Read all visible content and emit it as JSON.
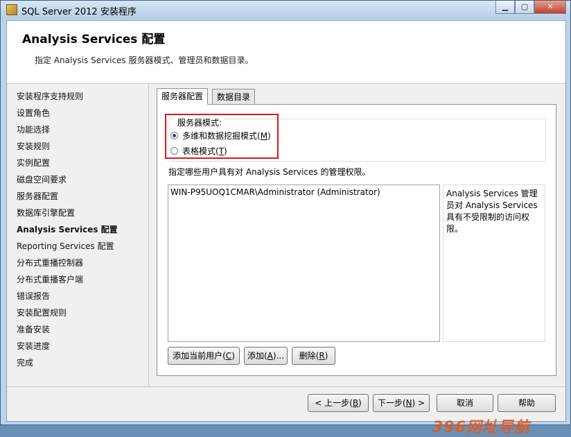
{
  "window": {
    "title": "SQL Server 2012 安装程序",
    "controls": {
      "minimize": "▁",
      "maximize": "▢",
      "close": "✕"
    }
  },
  "header": {
    "title": "Analysis  Services 配置",
    "subtitle": "指定 Analysis  Services 服务器模式、管理员和数据目录。"
  },
  "nav": {
    "items": [
      "安装程序支持规则",
      "设置角色",
      "功能选择",
      "安装规则",
      "实例配置",
      "磁盘空间要求",
      "服务器配置",
      "数据库引擎配置",
      "Analysis Services 配置",
      "Reporting Services 配置",
      "分布式重播控制器",
      "分布式重播客户端",
      "错误报告",
      "安装配置规则",
      "准备安装",
      "安装进度",
      "完成"
    ],
    "active_index": 8
  },
  "tabs": {
    "server_config": "服务器配置",
    "data_dirs": "数据目录"
  },
  "server_mode": {
    "label": "服务器模式:",
    "option1": {
      "text": "多维和数据挖掘模式(",
      "key": "M",
      "end": ")",
      "checked": true
    },
    "option2": {
      "text": "表格模式(",
      "key": "T",
      "end": ")",
      "checked": false
    }
  },
  "permissions": {
    "label": "指定哪些用户具有对 Analysis  Services 的管理权限。",
    "users": [
      "WIN-P95UOQ1CMAR\\Administrator (Administrator)"
    ],
    "description": "Analysis Services 管理员对 Analysis Services 具有不受限制的访问权限。"
  },
  "buttons": {
    "add_current": {
      "text": "添加当前用户(",
      "key": "C",
      "end": ")"
    },
    "add": {
      "text": "添加(",
      "key": "A",
      "end": ")..."
    },
    "remove": {
      "text": "删除(",
      "key": "R",
      "end": ")"
    },
    "back": {
      "text": "< 上一步(",
      "key": "B",
      "end": ")"
    },
    "next": {
      "text": "下一步(",
      "key": "N",
      "end": ") >"
    },
    "cancel": "取消",
    "help": "帮助"
  },
  "watermark": "396网址导航"
}
